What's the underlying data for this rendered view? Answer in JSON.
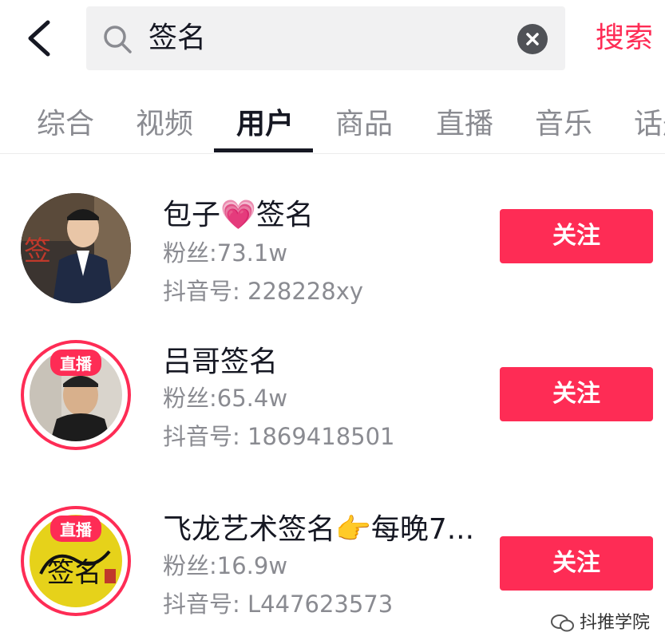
{
  "header": {
    "search_query": "签名",
    "search_button": "搜索"
  },
  "tabs": [
    {
      "label": "综合",
      "active": false
    },
    {
      "label": "视频",
      "active": false
    },
    {
      "label": "用户",
      "active": true
    },
    {
      "label": "商品",
      "active": false
    },
    {
      "label": "直播",
      "active": false
    },
    {
      "label": "音乐",
      "active": false
    },
    {
      "label": "话题",
      "active": false
    }
  ],
  "users": [
    {
      "name": "包子💗签名",
      "fans": "粉丝:73.1w",
      "douyin_id": "抖音号: 228228xy",
      "live": false,
      "follow_label": "关注",
      "avatar_text": "签"
    },
    {
      "name": "吕哥签名",
      "fans": "粉丝:65.4w",
      "douyin_id": "抖音号: 1869418501",
      "live": true,
      "live_label": "直播",
      "follow_label": "关注"
    },
    {
      "name": "飞龙艺术签名👉每晚7...",
      "fans": "粉丝:16.9w",
      "douyin_id": "抖音号: L447623573",
      "live": true,
      "live_label": "直播",
      "follow_label": "关注",
      "avatar_text": "签名"
    }
  ],
  "watermark": {
    "text": "抖推学院"
  },
  "colors": {
    "accent": "#fe2c55",
    "text": "#161823",
    "secondary": "#8a8b91",
    "search_bg": "#f1f1f2"
  },
  "icons": [
    "back-arrow-icon",
    "search-icon",
    "clear-icon",
    "wechat-icon"
  ]
}
